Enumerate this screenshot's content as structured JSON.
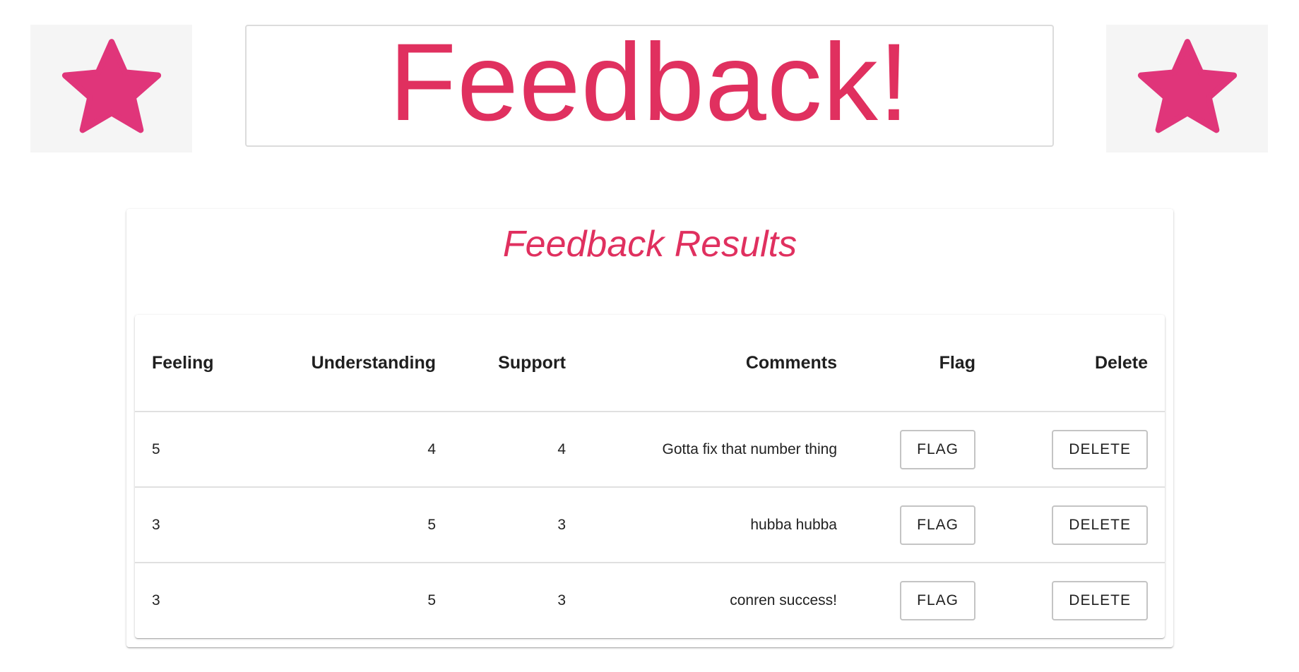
{
  "header": {
    "title": "Feedback!",
    "accent_color": "#e0305f",
    "star_color": "#e0357a"
  },
  "results": {
    "title": "Feedback Results",
    "columns": [
      "Feeling",
      "Understanding",
      "Support",
      "Comments",
      "Flag",
      "Delete"
    ],
    "rows": [
      {
        "feeling": "5",
        "understanding": "4",
        "support": "4",
        "comments": "Gotta fix that number thing",
        "flag_label": "FLAG",
        "delete_label": "DELETE"
      },
      {
        "feeling": "3",
        "understanding": "5",
        "support": "3",
        "comments": "hubba hubba",
        "flag_label": "FLAG",
        "delete_label": "DELETE"
      },
      {
        "feeling": "3",
        "understanding": "5",
        "support": "3",
        "comments": "conren success!",
        "flag_label": "FLAG",
        "delete_label": "DELETE"
      }
    ]
  }
}
